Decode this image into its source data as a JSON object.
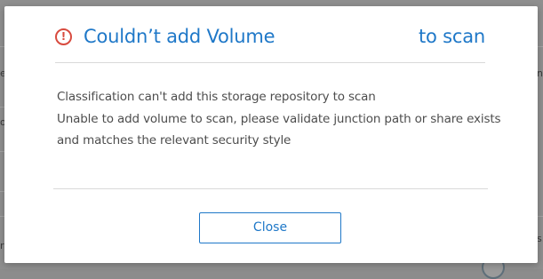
{
  "background": {
    "fragments": [
      "e",
      "n",
      "o",
      "s.",
      "r"
    ]
  },
  "dialog": {
    "title": "Couldn’t add Volume",
    "title_suffix": "to scan",
    "body_lines": [
      "Classification can't add this storage repository to scan",
      "Unable to add volume to scan, please validate junction path or share exists",
      "and matches the relevant security style"
    ],
    "close_label": "Close",
    "colors": {
      "accent": "#1f78c8",
      "error": "#d84b3f"
    },
    "icon": "error-circle-icon"
  }
}
